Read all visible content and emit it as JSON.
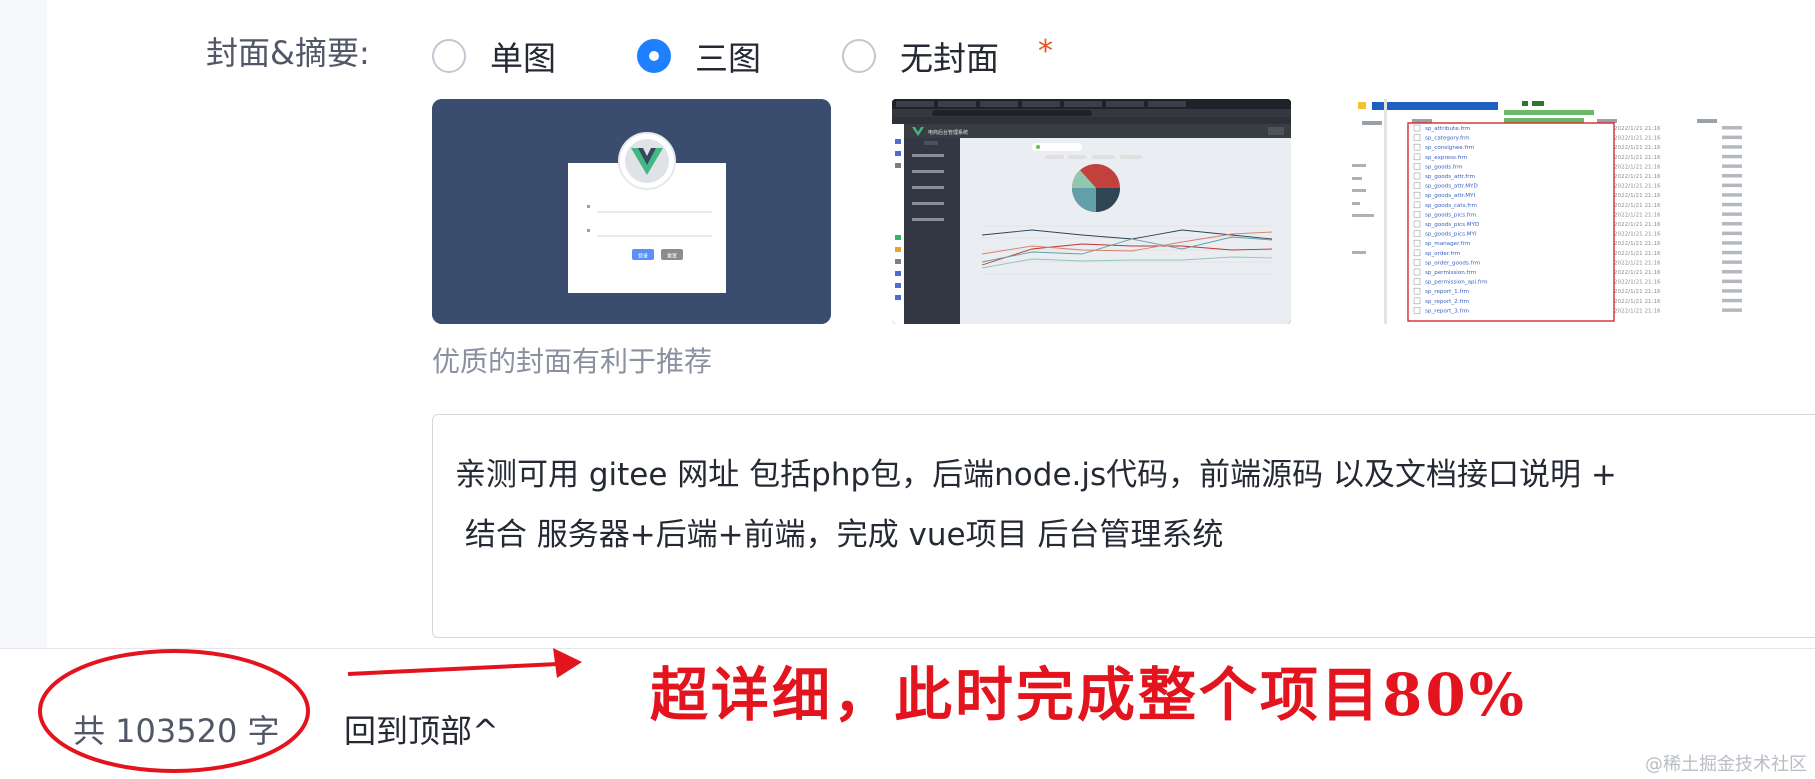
{
  "cover": {
    "label": "封面&摘要:",
    "options": [
      "单图",
      "三图",
      "无封面"
    ],
    "selected": "三图",
    "required_mark": "*",
    "hint": "优质的封面有利于推荐"
  },
  "thumbnails": {
    "thumb1": {
      "btn_primary": "登录",
      "btn_secondary": "重置"
    },
    "thumb2": {
      "app_title": "电商后台管理系统"
    },
    "thumb3": {
      "files": [
        "sp_attribute.frm",
        "sp_category.frm",
        "sp_consignee.frm",
        "sp_express.frm",
        "sp_goods.frm",
        "sp_goods_attr.frm",
        "sp_goods_attr.MYD",
        "sp_goods_attr.MYI",
        "sp_goods_cats.frm",
        "sp_goods_pics.frm",
        "sp_goods_pics.MYD",
        "sp_goods_pics.MYI",
        "sp_manager.frm",
        "sp_order.frm",
        "sp_order_goods.frm",
        "sp_permission.frm",
        "sp_permission_api.frm",
        "sp_report_1.frm",
        "sp_report_2.frm",
        "sp_report_3.frm"
      ],
      "date": "2022/1/21 21:16"
    }
  },
  "abstract": {
    "text": "亲测可用 gitee 网址 包括php包，后端node.js代码，前端源码 以及文档接口说明 +\n 结合 服务器+后端+前端，完成 vue项目 后台管理系统"
  },
  "footer": {
    "word_count": "共 103520 字",
    "back_to_top": "回到顶部^",
    "annotation": "超详细，此时完成整个项目80%",
    "watermark": "@稀土掘金技术社区"
  },
  "colors": {
    "accent": "#1e80ff",
    "annotation_red": "#e3141e",
    "required": "#e8501e"
  }
}
